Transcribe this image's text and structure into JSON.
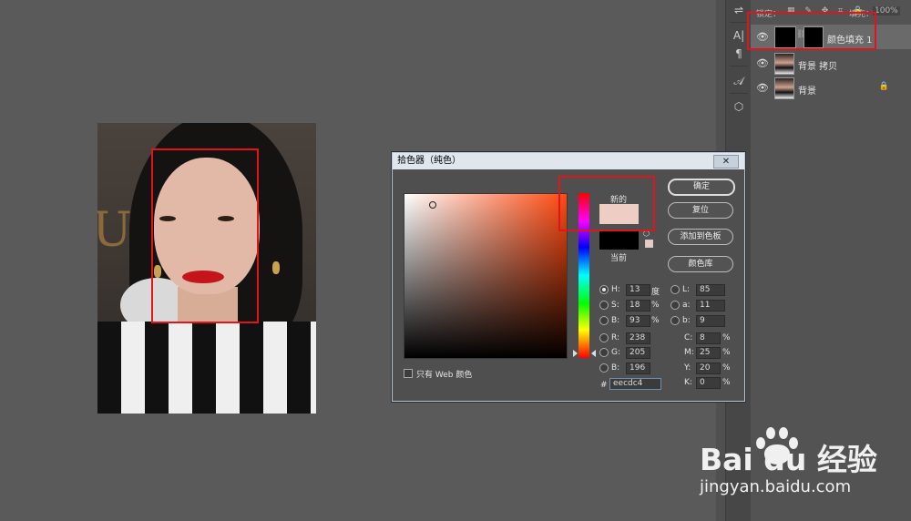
{
  "layers_panel": {
    "lock_label": "锁定：",
    "fill_label": "填充：",
    "fill_value": "100%",
    "layers": [
      {
        "name": "颜色填充 1",
        "selected": true
      },
      {
        "name": "背景 拷贝",
        "selected": false
      },
      {
        "name": "背景",
        "selected": false,
        "locked": true
      }
    ]
  },
  "side_tools": [
    {
      "icon": "adjust-icon",
      "glyph": "⇌"
    },
    {
      "icon": "character-icon",
      "glyph": "A|"
    },
    {
      "icon": "paragraph-icon",
      "glyph": "¶"
    },
    {
      "icon": "glyph-icon",
      "glyph": "𝒜"
    },
    {
      "icon": "3d-icon",
      "glyph": "⬡"
    }
  ],
  "color_picker": {
    "title": "拾色器（纯色）",
    "close_glyph": "✕",
    "new_label": "新的",
    "current_label": "当前",
    "new_color": "#eecdc4",
    "current_color": "#000000",
    "buttons": {
      "ok": "确定",
      "reset": "复位",
      "add_swatch": "添加到色板",
      "color_library": "颜色库"
    },
    "web_only_label": "只有 Web 颜色",
    "hsb": [
      {
        "label": "H:",
        "value": "13",
        "unit": "度",
        "selected": true
      },
      {
        "label": "S:",
        "value": "18",
        "unit": "%"
      },
      {
        "label": "B:",
        "value": "93",
        "unit": "%"
      }
    ],
    "rgb": [
      {
        "label": "R:",
        "value": "238"
      },
      {
        "label": "G:",
        "value": "205"
      },
      {
        "label": "B:",
        "value": "196"
      }
    ],
    "lab": [
      {
        "label": "L:",
        "value": "85"
      },
      {
        "label": "a:",
        "value": "11"
      },
      {
        "label": "b:",
        "value": "9"
      }
    ],
    "cmyk": [
      {
        "label": "C:",
        "value": "8",
        "unit": "%"
      },
      {
        "label": "M:",
        "value": "25",
        "unit": "%"
      },
      {
        "label": "Y:",
        "value": "20",
        "unit": "%"
      },
      {
        "label": "K:",
        "value": "0",
        "unit": "%"
      }
    ],
    "hex_label": "#",
    "hex_value": "eecdc4"
  },
  "photo": {
    "sign_text": "UD"
  },
  "watermark": {
    "brand": "Bai  du 经验",
    "url": "jingyan.baidu.com"
  },
  "highlight_color": "#e0141a"
}
